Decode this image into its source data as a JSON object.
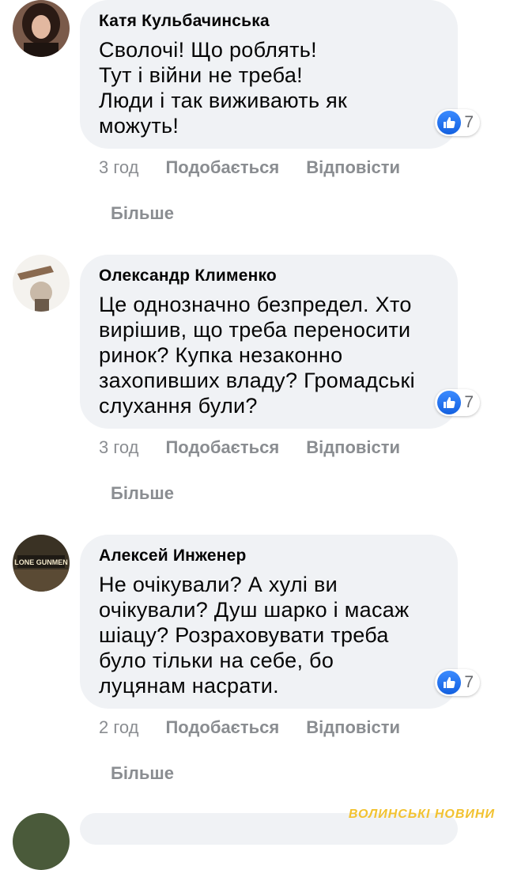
{
  "comments": [
    {
      "author": "Катя Кульбачинська",
      "lines": [
        "Сволочі! Що роблять!",
        "Тут і війни не треба!",
        "Люди і так виживають як",
        "можуть!"
      ],
      "reaction_count": "7",
      "time": "3 год",
      "like_label": "Подобається",
      "reply_label": "Відповісти",
      "more_label": "Більше"
    },
    {
      "author": "Олександр Клименко",
      "lines": [
        "Це однозначно безпредел. Хто",
        "вирішив, що треба переносити",
        "ринок? Купка незаконно",
        "захопивших владу? Громадські",
        "слухання були?"
      ],
      "reaction_count": "7",
      "time": "3 год",
      "like_label": "Подобається",
      "reply_label": "Відповісти",
      "more_label": "Більше"
    },
    {
      "author": "Алексей Инженер",
      "lines": [
        "Не очікували? А хулі ви",
        "очікували? Душ шарко і масаж",
        "шіацу? Розраховувати треба",
        "було тільки на себе, бо",
        "луцянам насрати."
      ],
      "reaction_count": "7",
      "time": "2 год",
      "like_label": "Подобається",
      "reply_label": "Відповісти",
      "more_label": "Більше"
    }
  ],
  "avatar_text_3": "LONE GUNMEN",
  "watermark": "ВОЛИНСЬКІ НОВИНИ",
  "colors": {
    "bubble": "#f0f2f5",
    "like_blue": "#1877f2",
    "meta_gray": "#8a8d91"
  }
}
